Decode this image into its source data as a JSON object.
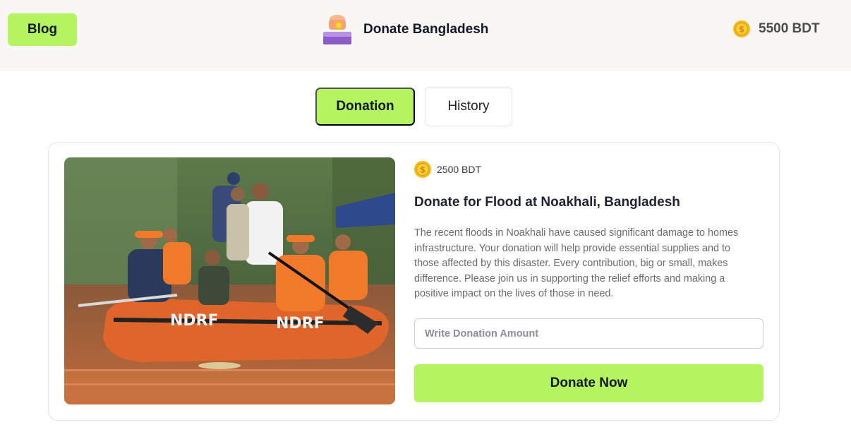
{
  "header": {
    "blog_label": "Blog",
    "brand_title": "Donate Bangladesh",
    "brand_logo_icon": "donation-box-icon",
    "balance_icon": "coin-icon",
    "balance_text": "5500 BDT"
  },
  "tabs": [
    {
      "label": "Donation",
      "active": true
    },
    {
      "label": "History",
      "active": false
    }
  ],
  "donation_card": {
    "image_subject": "flood-rescue-boat-photo",
    "amount_icon": "coin-icon",
    "amount_text": "2500 BDT",
    "title": "Donate for Flood at Noakhali, Bangladesh",
    "description": "The recent floods in Noakhali have caused significant damage to homes infrastructure. Your donation will help provide essential supplies and to those affected by this disaster. Every contribution, big or small, makes difference. Please join us in supporting the relief efforts and making a positive impact on the lives of those in need.",
    "input_placeholder": "Write Donation Amount",
    "input_value": "",
    "button_label": "Donate Now"
  },
  "colors": {
    "accent": "#b4f461",
    "header_bg": "#f9f7f3",
    "coin": "#f5b919"
  }
}
